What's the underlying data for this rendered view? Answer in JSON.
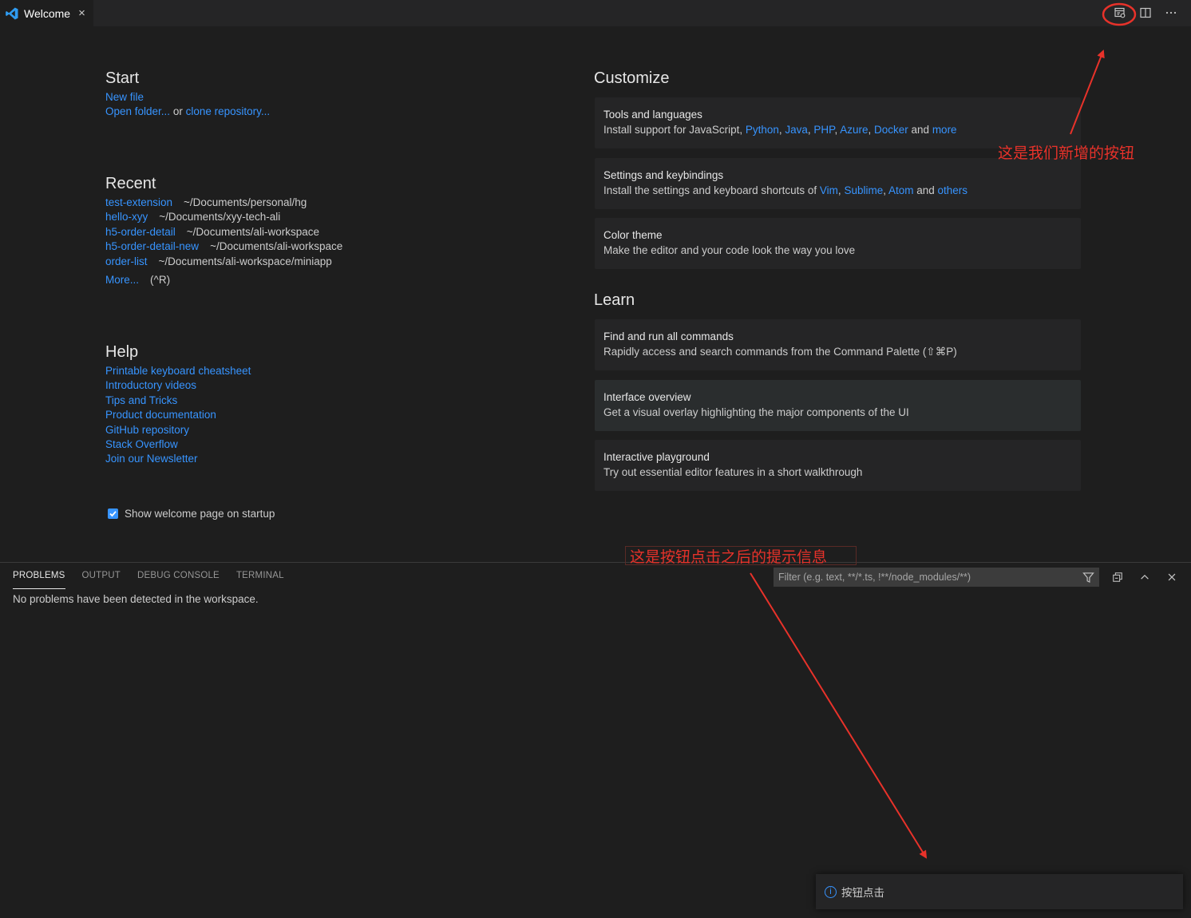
{
  "tab": {
    "label": "Welcome",
    "close": "×"
  },
  "header_actions": [
    "new-action-icon",
    "split-editor-icon",
    "more-actions-icon"
  ],
  "start": {
    "title": "Start",
    "new_file": "New file",
    "open_folder": "Open folder...",
    "or": " or ",
    "clone_repo": "clone repository..."
  },
  "recent": {
    "title": "Recent",
    "items": [
      {
        "name": "test-extension",
        "path": "~/Documents/personal/hg"
      },
      {
        "name": "hello-xyy",
        "path": "~/Documents/xyy-tech-ali"
      },
      {
        "name": "h5-order-detail",
        "path": "~/Documents/ali-workspace"
      },
      {
        "name": "h5-order-detail-new",
        "path": "~/Documents/ali-workspace"
      },
      {
        "name": "order-list",
        "path": "~/Documents/ali-workspace/miniapp"
      }
    ],
    "more": "More...",
    "shortcut": "(^R)"
  },
  "help": {
    "title": "Help",
    "links": [
      "Printable keyboard cheatsheet",
      "Introductory videos",
      "Tips and Tricks",
      "Product documentation",
      "GitHub repository",
      "Stack Overflow",
      "Join our Newsletter"
    ]
  },
  "startup_checkbox": {
    "label": "Show welcome page on startup",
    "checked": true
  },
  "customize": {
    "title": "Customize",
    "tools": {
      "title": "Tools and languages",
      "prefix": "Install support for JavaScript, ",
      "python": "Python",
      "java": "Java",
      "php": "PHP",
      "azure": "Azure",
      "docker": "Docker",
      "comma": ", ",
      "and": " and ",
      "more": "more"
    },
    "settings": {
      "title": "Settings and keybindings",
      "prefix": "Install the settings and keyboard shortcuts of ",
      "vim": "Vim",
      "sublime": "Sublime",
      "atom": "Atom",
      "others": "others",
      "comma": ", ",
      "and": " and "
    },
    "theme": {
      "title": "Color theme",
      "desc": "Make the editor and your code look the way you love"
    }
  },
  "learn": {
    "title": "Learn",
    "cards": [
      {
        "title": "Find and run all commands",
        "desc": "Rapidly access and search commands from the Command Palette (⇧⌘P)"
      },
      {
        "title": "Interface overview",
        "desc": "Get a visual overlay highlighting the major components of the UI"
      },
      {
        "title": "Interactive playground",
        "desc": "Try out essential editor features in a short walkthrough"
      }
    ]
  },
  "panel": {
    "tabs": [
      "PROBLEMS",
      "OUTPUT",
      "DEBUG CONSOLE",
      "TERMINAL"
    ],
    "active_tab": "PROBLEMS",
    "filter_placeholder": "Filter (e.g. text, **/*.ts, !**/node_modules/**)",
    "message": "No problems have been detected in the workspace."
  },
  "notification": {
    "icon": "info-icon",
    "text": "按钮点击"
  },
  "annotations": {
    "new_button_note": "这是我们新增的按钮",
    "tip_note": "这是按钮点击之后的提示信息",
    "color": "#e8322a"
  },
  "colors": {
    "link": "#3794ff",
    "background": "#1e1e1e",
    "tabbar": "#252526"
  }
}
